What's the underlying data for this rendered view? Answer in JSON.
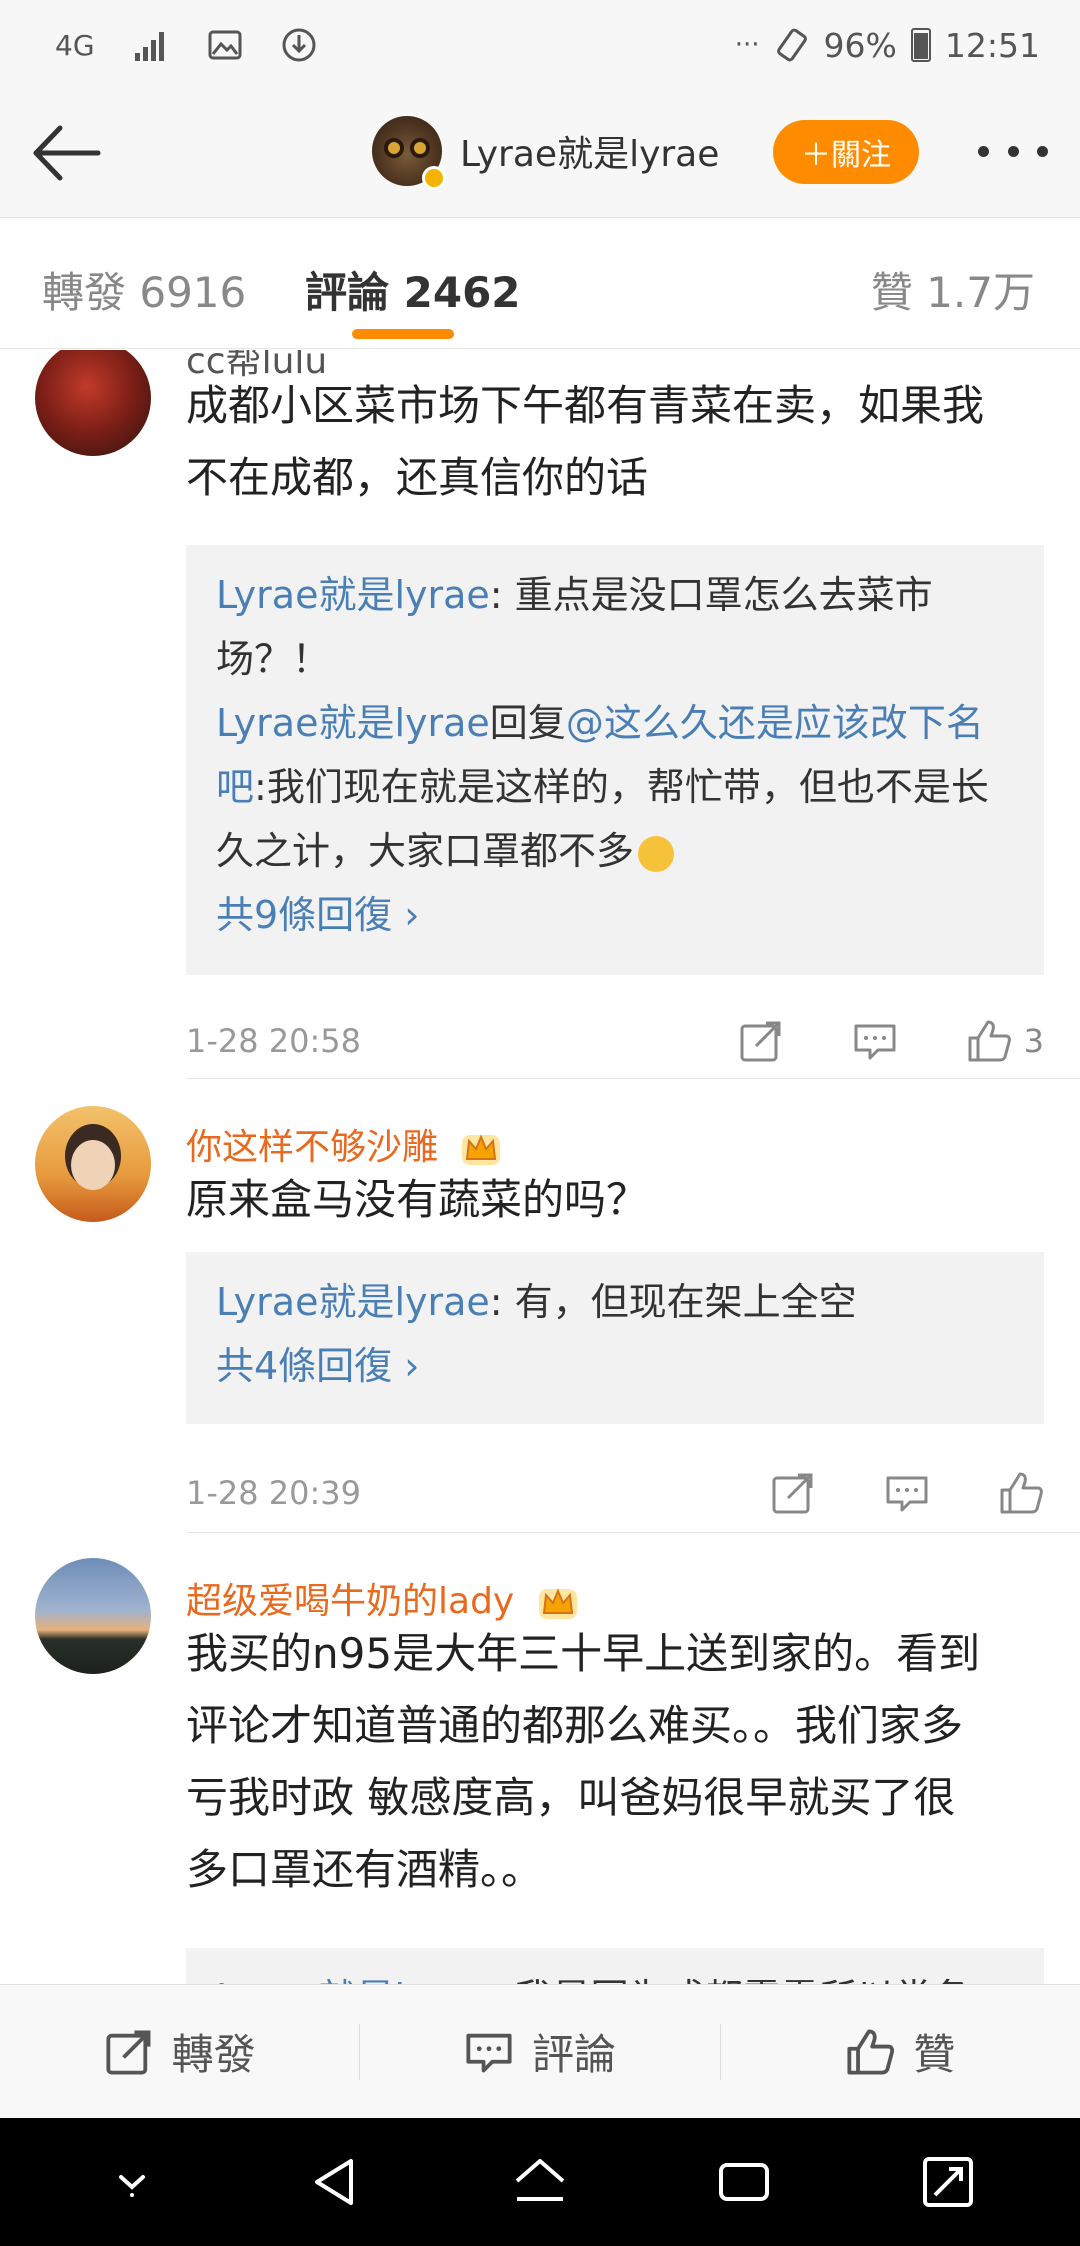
{
  "status_bar": {
    "network": "4G",
    "battery": "96%",
    "time": "12:51",
    "more": "···"
  },
  "header": {
    "profile_name": "Lyrae就是lyrae",
    "follow_label": "＋關注"
  },
  "tabs": {
    "repost": "轉發 6916",
    "comment": "評論 2462",
    "like": "贊 1.7万"
  },
  "comments": [
    {
      "name": "cc帮lulu",
      "text_lines": [
        "成都小区菜市场下午都有青菜在卖，如果我",
        "不在成都，还真信你的话"
      ],
      "replies": [
        {
          "author": "Lyrae就是lyrae",
          "line1": ": 重点是没口罩怎么去菜市",
          "line2": "场？！"
        },
        {
          "author": "Lyrae就是lyrae",
          "reply_word": "回复",
          "mention": "@这么久还是应该改下名",
          "mention2": "吧",
          "line1": ":我们现在就是这样的，帮忙带，但也不是长",
          "line2": "久之计，大家口罩都不多"
        }
      ],
      "total_replies": "共9條回復 ›",
      "time": "1-28 20:58",
      "likes": "3"
    },
    {
      "name": "你这样不够沙雕",
      "text_lines": [
        "原来盒马没有蔬菜的吗？"
      ],
      "replies": [
        {
          "author": "Lyrae就是lyrae",
          "line1": ": 有，但现在架上全空"
        }
      ],
      "total_replies": "共4條回復 ›",
      "time": "1-28 20:39",
      "likes": ""
    },
    {
      "name": "超级爱喝牛奶的lady",
      "text_lines": [
        "我买的n95是大年三十早上送到家的。看到",
        "评论才知道普通的都那么难买。。我们家多",
        "亏我时政 敏感度高，叫爸妈很早就买了很",
        "多口罩还有酒精。。"
      ],
      "replies": [
        {
          "author": "Lyrae就是lyrae",
          "line1": ": 我是因为成都雾霾所以常备"
        }
      ]
    }
  ],
  "bottom_bar": {
    "repost": "轉發",
    "comment": "評論",
    "like": "贊"
  },
  "colors": {
    "accent": "#ff8c00",
    "link": "#4a7fb5",
    "name_vip": "#e86a1f"
  }
}
